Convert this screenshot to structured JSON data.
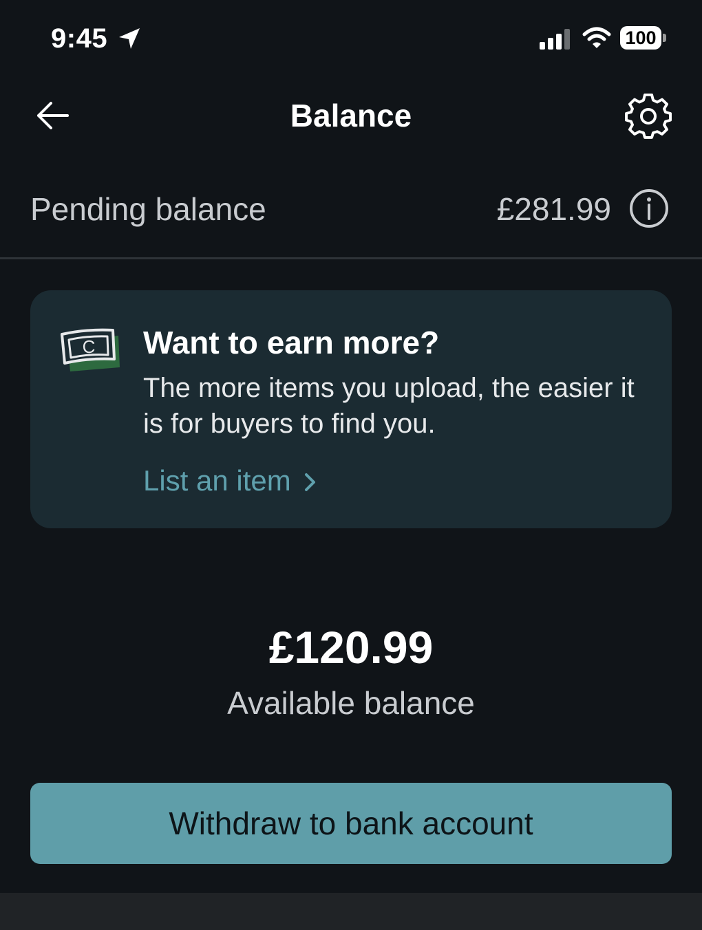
{
  "status_bar": {
    "time": "9:45",
    "battery": "100"
  },
  "header": {
    "title": "Balance"
  },
  "pending": {
    "label": "Pending balance",
    "amount": "£281.99"
  },
  "promo": {
    "icon_letter": "C",
    "title": "Want to earn more?",
    "body": "The more items you upload, the easier it is for buyers to find you.",
    "link_label": "List an item"
  },
  "available": {
    "amount": "£120.99",
    "label": "Available balance"
  },
  "withdraw": {
    "label": "Withdraw to bank account"
  },
  "colors": {
    "background": "#101418",
    "card": "#1b2b32",
    "accent": "#5f9ea9",
    "link": "#5fa0ad"
  },
  "icons": [
    "location-arrow-icon",
    "signal-icon",
    "wifi-icon",
    "battery-icon",
    "back-arrow-icon",
    "gear-icon",
    "info-icon",
    "money-note-icon",
    "chevron-right-icon"
  ]
}
